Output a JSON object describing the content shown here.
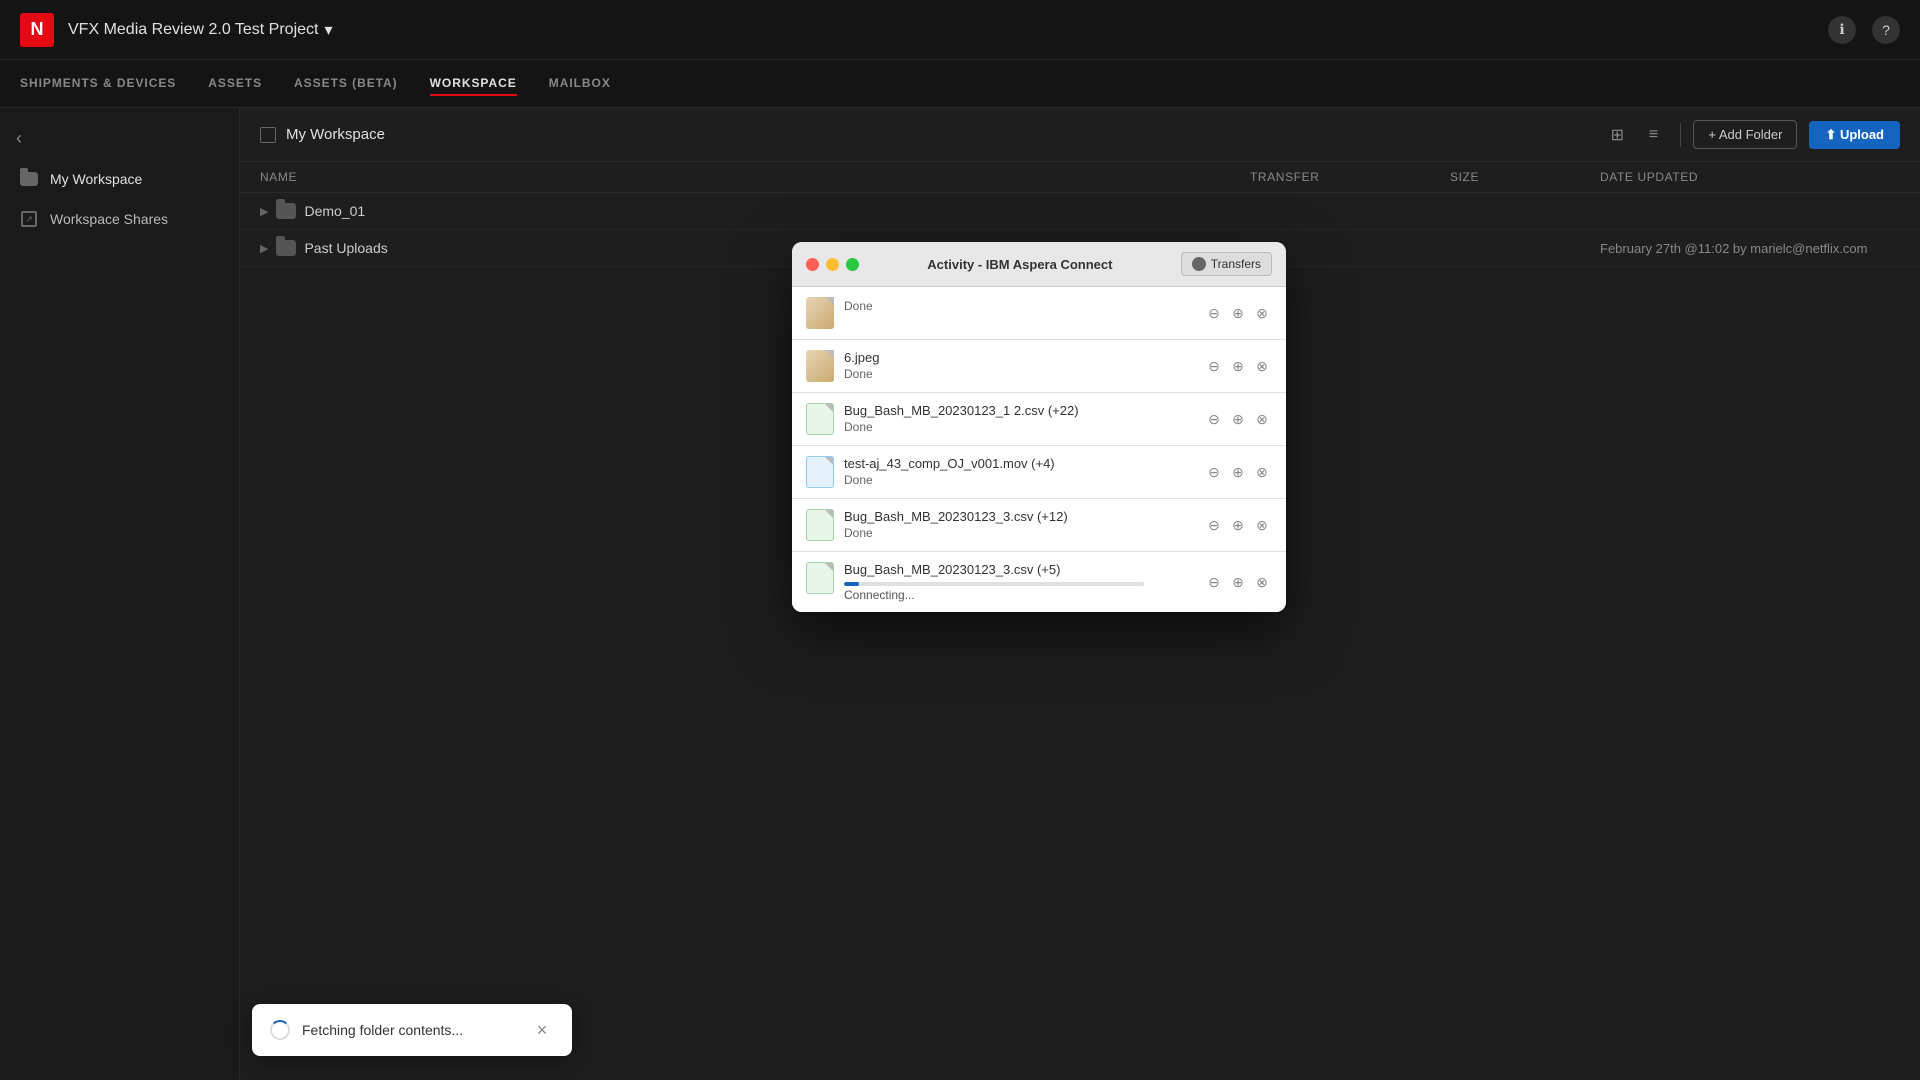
{
  "app": {
    "logo": "N",
    "project_title": "VFX Media Review 2.0 Test Project",
    "dropdown_arrow": "▾"
  },
  "nav": {
    "items": [
      {
        "id": "shipments",
        "label": "SHIPMENTS & DEVICES",
        "active": false
      },
      {
        "id": "assets",
        "label": "ASSETS",
        "active": false
      },
      {
        "id": "assets_beta",
        "label": "ASSETS (BETA)",
        "active": false
      },
      {
        "id": "workspace",
        "label": "WORKSPACE",
        "active": true
      },
      {
        "id": "mailbox",
        "label": "MAILBOX",
        "active": false
      }
    ]
  },
  "sidebar": {
    "back_label": "‹",
    "items": [
      {
        "id": "my_workspace",
        "label": "My Workspace",
        "active": true,
        "icon": "folder"
      },
      {
        "id": "workspace_shares",
        "label": "Workspace Shares",
        "active": false,
        "icon": "share"
      }
    ]
  },
  "content": {
    "header_title": "My Workspace",
    "add_folder_label": "+ Add Folder",
    "upload_label": "⬆ Upload",
    "table_headers": [
      "Name",
      "Transfer",
      "Size",
      "Date Updated"
    ],
    "rows": [
      {
        "name": "Demo_01",
        "transfer": "",
        "size": "",
        "date": ""
      },
      {
        "name": "Past Uploads",
        "transfer": "",
        "size": "",
        "date": "February 27th @11:02 by marielc@netflix.com"
      }
    ]
  },
  "aspera_dialog": {
    "title": "Activity - IBM Aspera Connect",
    "transfers_btn": "Transfers",
    "dot_red": "close",
    "dot_yellow": "minimize",
    "dot_green": "maximize",
    "transfer_items": [
      {
        "id": 1,
        "filename": "",
        "status": "Done",
        "type": "img"
      },
      {
        "id": 2,
        "filename": "6.jpeg",
        "status": "Done",
        "type": "img"
      },
      {
        "id": 3,
        "filename": "Bug_Bash_MB_20230123_1 2.csv (+22)",
        "status": "Done",
        "type": "csv"
      },
      {
        "id": 4,
        "filename": "test-aj_43_comp_OJ_v001.mov (+4)",
        "status": "Done",
        "type": "mov"
      },
      {
        "id": 5,
        "filename": "Bug_Bash_MB_20230123_3.csv (+12)",
        "status": "Done",
        "type": "csv"
      },
      {
        "id": 6,
        "filename": "Bug_Bash_MB_20230123_3.csv (+5)",
        "status": "Connecting...",
        "type": "csv",
        "progress": 5
      }
    ]
  },
  "toast": {
    "message": "Fetching folder contents...",
    "close_label": "×"
  },
  "icons": {
    "grid_view": "⊞",
    "list_view": "≡",
    "info": "ℹ",
    "help": "?"
  }
}
